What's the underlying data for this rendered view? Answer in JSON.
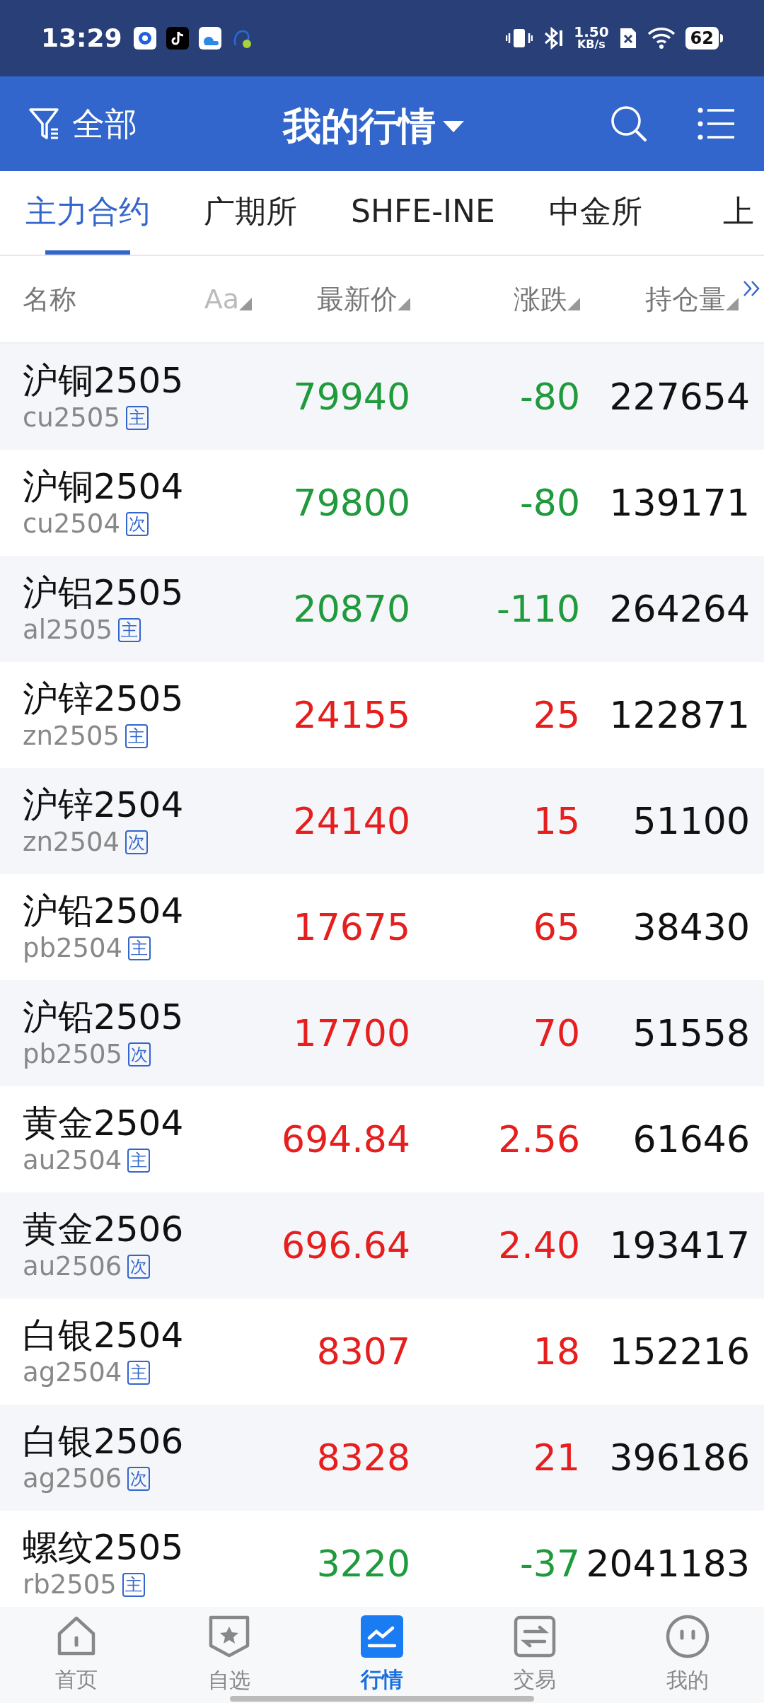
{
  "status_bar": {
    "time": "13:29",
    "speed": "1.50",
    "speed_unit": "KB/s",
    "battery": "62"
  },
  "header": {
    "filter": "全部",
    "title": "我的行情"
  },
  "tabs": [
    {
      "label": "主力合约",
      "selected": true
    },
    {
      "label": "广期所",
      "selected": false
    },
    {
      "label": "SHFE-INE",
      "selected": false
    },
    {
      "label": "中金所",
      "selected": false
    },
    {
      "label": "上",
      "selected": false
    }
  ],
  "columns": [
    "名称",
    "Aa",
    "最新价",
    "涨跌",
    "持仓量"
  ],
  "rows": [
    {
      "name": "沪铜2505",
      "code": "cu2505",
      "badge": "主",
      "price": "79940",
      "change": "-80",
      "open_interest": "227654",
      "color": "#1f9a3c"
    },
    {
      "name": "沪铜2504",
      "code": "cu2504",
      "badge": "次",
      "price": "79800",
      "change": "-80",
      "open_interest": "139171",
      "color": "#1f9a3c"
    },
    {
      "name": "沪铝2505",
      "code": "al2505",
      "badge": "主",
      "price": "20870",
      "change": "-110",
      "open_interest": "264264",
      "color": "#1f9a3c"
    },
    {
      "name": "沪锌2505",
      "code": "zn2505",
      "badge": "主",
      "price": "24155",
      "change": "25",
      "open_interest": "122871",
      "color": "#e61e1e"
    },
    {
      "name": "沪锌2504",
      "code": "zn2504",
      "badge": "次",
      "price": "24140",
      "change": "15",
      "open_interest": "51100",
      "color": "#e61e1e"
    },
    {
      "name": "沪铅2504",
      "code": "pb2504",
      "badge": "主",
      "price": "17675",
      "change": "65",
      "open_interest": "38430",
      "color": "#e61e1e"
    },
    {
      "name": "沪铅2505",
      "code": "pb2505",
      "badge": "次",
      "price": "17700",
      "change": "70",
      "open_interest": "51558",
      "color": "#e61e1e"
    },
    {
      "name": "黄金2504",
      "code": "au2504",
      "badge": "主",
      "price": "694.84",
      "change": "2.56",
      "open_interest": "61646",
      "color": "#e61e1e"
    },
    {
      "name": "黄金2506",
      "code": "au2506",
      "badge": "次",
      "price": "696.64",
      "change": "2.40",
      "open_interest": "193417",
      "color": "#e61e1e"
    },
    {
      "name": "白银2504",
      "code": "ag2504",
      "badge": "主",
      "price": "8307",
      "change": "18",
      "open_interest": "152216",
      "color": "#e61e1e"
    },
    {
      "name": "白银2506",
      "code": "ag2506",
      "badge": "次",
      "price": "8328",
      "change": "21",
      "open_interest": "396186",
      "color": "#e61e1e"
    },
    {
      "name": "螺纹2505",
      "code": "rb2505",
      "badge": "主",
      "price": "3220",
      "change": "-37",
      "open_interest": "2041183",
      "color": "#1f9a3c"
    }
  ],
  "nav": [
    {
      "label": "首页",
      "kind": "home",
      "selected": false
    },
    {
      "label": "自选",
      "kind": "watchlist",
      "selected": false
    },
    {
      "label": "行情",
      "kind": "market",
      "selected": true
    },
    {
      "label": "交易",
      "kind": "trade",
      "selected": false
    },
    {
      "label": "我的",
      "kind": "profile",
      "selected": false
    }
  ]
}
